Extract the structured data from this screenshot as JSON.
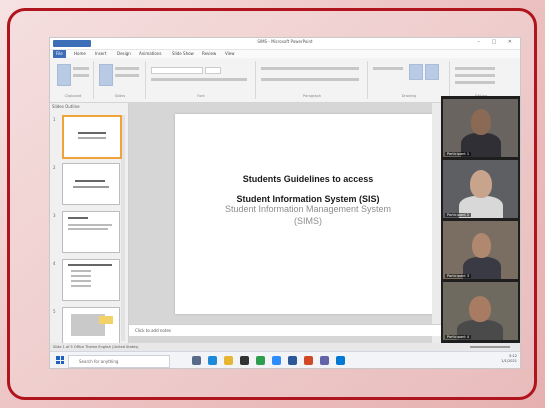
{
  "window": {
    "title": "SIMS - Microsoft PowerPoint",
    "controls": "–  □  ✕",
    "quick_access": "QAT"
  },
  "ribbon": {
    "tabs": [
      "File",
      "Home",
      "Insert",
      "Design",
      "Animations",
      "Slide Show",
      "Review",
      "View"
    ],
    "groups": [
      "Clipboard",
      "Slides",
      "Font",
      "Paragraph",
      "Drawing",
      "Editing"
    ]
  },
  "pane": {
    "tabs_label": "Slides   Outline",
    "thumbnails": [
      {
        "num": "1",
        "selected": true
      },
      {
        "num": "2",
        "selected": false
      },
      {
        "num": "3",
        "selected": false
      },
      {
        "num": "4",
        "selected": false
      },
      {
        "num": "5",
        "selected": false
      }
    ]
  },
  "slide": {
    "title_line1": "Students Guidelines to access",
    "title_line2": "Student Information System  (SIS)",
    "ghost_line1": "Student Information Management System",
    "ghost_line2": "(SIMS)"
  },
  "notes": {
    "placeholder": "Click to add notes"
  },
  "videos": {
    "tiles": [
      {
        "label": "Participant 1",
        "bg": "#6a6460",
        "skin": "#8b6a55",
        "shirt": "#2f2f35"
      },
      {
        "label": "Participant 2",
        "bg": "#5d5f63",
        "skin": "#c9a48c",
        "shirt": "#d8d8d8"
      },
      {
        "label": "Participant 3",
        "bg": "#7a6e62",
        "skin": "#b08870",
        "shirt": "#3a3a44"
      },
      {
        "label": "Participant 4",
        "bg": "#6e6a60",
        "skin": "#a77c62",
        "shirt": "#4a4a4a"
      }
    ]
  },
  "statusbar": {
    "left": "Slide 1 of 5   Office Theme   English (United States)"
  },
  "taskbar": {
    "search_placeholder": "Search for anything",
    "time": "5:12",
    "date": "1/1/2021",
    "icons": [
      {
        "name": "task-view-icon",
        "color": "#5a6b8a"
      },
      {
        "name": "edge-icon",
        "color": "#1c8ad9"
      },
      {
        "name": "file-explorer-icon",
        "color": "#e8b530"
      },
      {
        "name": "store-icon",
        "color": "#333333"
      },
      {
        "name": "chrome-icon",
        "color": "#2d9d4f"
      },
      {
        "name": "zoom-icon",
        "color": "#2d8cff"
      },
      {
        "name": "word-icon",
        "color": "#2b579a"
      },
      {
        "name": "powerpoint-icon",
        "color": "#d24726"
      },
      {
        "name": "teams-icon",
        "color": "#6264a7"
      },
      {
        "name": "mail-icon",
        "color": "#0078d4"
      }
    ]
  },
  "colors": {
    "frame_border": "#b0141d",
    "accent": "#3d6fb8",
    "thumb_selected": "#f0a33a"
  }
}
